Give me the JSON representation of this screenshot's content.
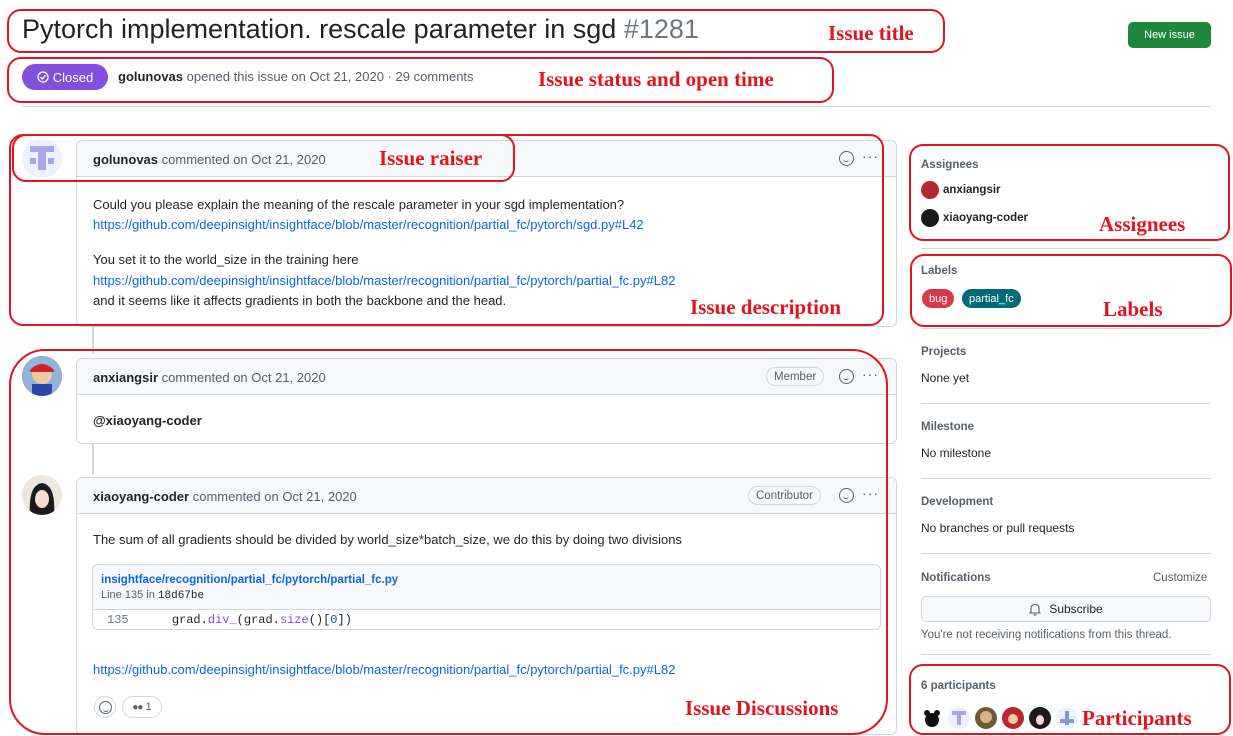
{
  "issue": {
    "title": "Pytorch implementation. rescale parameter in sgd",
    "number": "#1281",
    "new_issue_label": "New issue",
    "status_label": "Closed",
    "opener": "golunovas",
    "opened_text": "opened this issue on Oct 21, 2020 · 29 comments"
  },
  "comments": [
    {
      "author": "golunovas",
      "meta": "commented on Oct 21, 2020",
      "lines": [
        "Could you please explain the meaning of the rescale parameter in your sgd implementation?",
        "https://github.com/deepinsight/insightface/blob/master/recognition/partial_fc/pytorch/sgd.py#L42",
        "You set it to the world_size in the training here",
        "https://github.com/deepinsight/insightface/blob/master/recognition/partial_fc/pytorch/partial_fc.py#L82",
        "and it seems like it affects gradients in both the backbone and the head."
      ]
    },
    {
      "author": "anxiangsir",
      "meta": "commented on Oct 21, 2020",
      "role": "Member",
      "lines": [
        "@xiaoyang-coder"
      ]
    },
    {
      "author": "xiaoyang-coder",
      "meta": "commented on Oct 21, 2020",
      "role": "Contributor",
      "lines": [
        "The sum of all gradients should be divided by world_size*batch_size, we do this by doing two divisions",
        "https://github.com/deepinsight/insightface/blob/master/recognition/partial_fc/pytorch/partial_fc.py#L82"
      ],
      "snippet": {
        "path": "insightface/recognition/partial_fc/pytorch/partial_fc.py",
        "line_prefix": "Line 135 in",
        "commit": "18d67be",
        "line_number": "135",
        "code_obj": "grad.",
        "code_fn": "div_",
        "code_mid": "(grad.",
        "code_fn2": "size",
        "code_end": "()[",
        "code_idx": "0",
        "code_close": "])"
      },
      "reactions": [
        {
          "icon": "smiley-icon",
          "count": ""
        },
        {
          "icon": "eyes-icon",
          "count": "1"
        }
      ]
    }
  ],
  "sidebar": {
    "assignees_label": "Assignees",
    "assignees": [
      "anxiangsir",
      "xiaoyang-coder"
    ],
    "labels_label": "Labels",
    "labels": [
      {
        "name": "bug",
        "color": "#d73a4a"
      },
      {
        "name": "partial_fc",
        "color": "#006b75"
      }
    ],
    "projects_label": "Projects",
    "projects_value": "None yet",
    "milestone_label": "Milestone",
    "milestone_value": "No milestone",
    "development_label": "Development",
    "development_value": "No branches or pull requests",
    "notifications_label": "Notifications",
    "customize_label": "Customize",
    "subscribe_label": "Subscribe",
    "notifications_note": "You're not receiving notifications from this thread.",
    "participants_label": "6 participants"
  },
  "annotations": {
    "issue_title": "Issue title",
    "status_time": "Issue status and open time",
    "raiser": "Issue raiser",
    "description": "Issue description",
    "discussions": "Issue Discussions",
    "assignees": "Assignees",
    "labels": "Labels",
    "participants": "Participants"
  },
  "colors": {
    "closed": "#8250df",
    "new_issue": "#1f883d",
    "link": "#0969da",
    "annotation": "#e3141f"
  }
}
